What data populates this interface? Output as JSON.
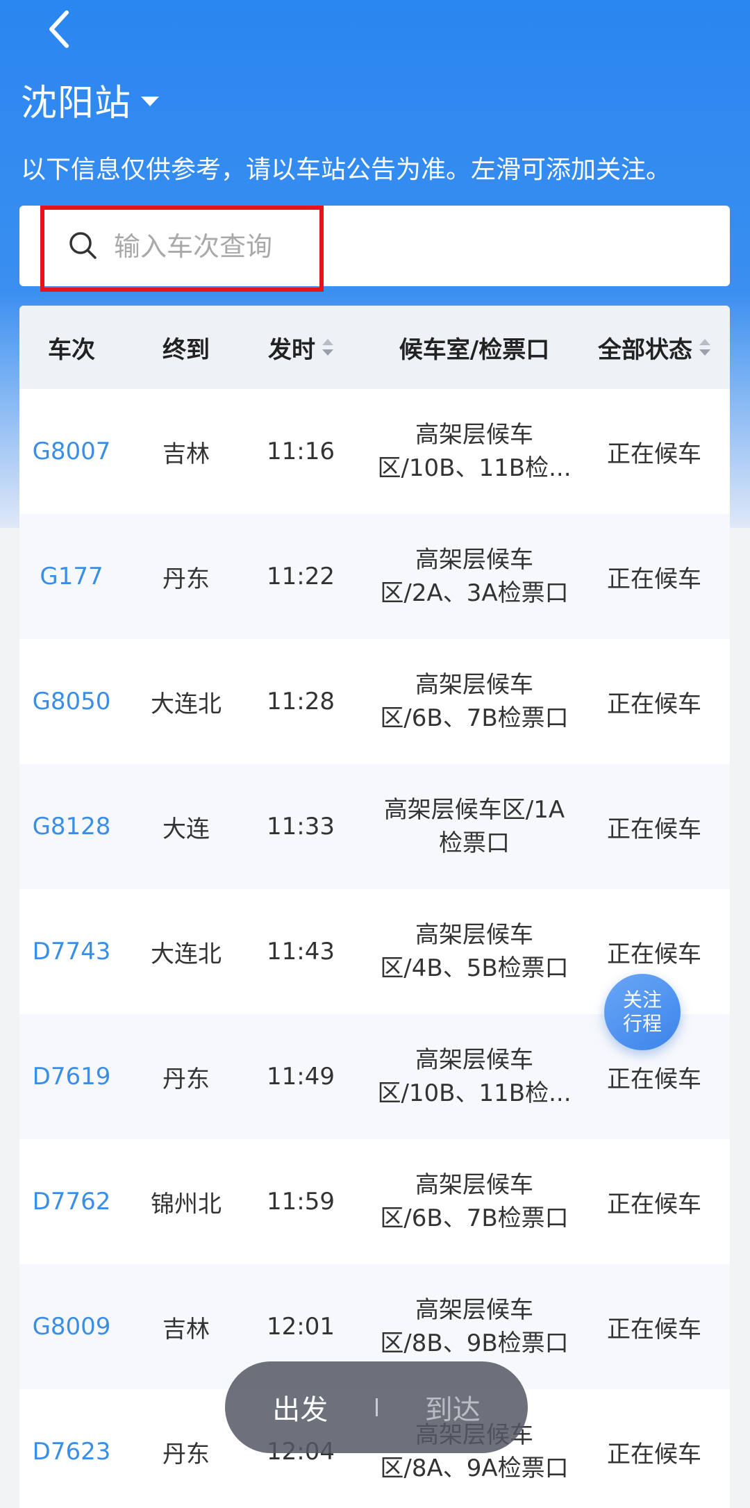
{
  "header": {
    "station": "沈阳站",
    "notice": "以下信息仅供参考，请以车站公告为准。左滑可添加关注。"
  },
  "search": {
    "placeholder": "输入车次查询"
  },
  "table": {
    "columns": [
      "车次",
      "终到",
      "发时",
      "候车室/检票口",
      "全部状态"
    ],
    "rows": [
      {
        "train": "G8007",
        "dest": "吉林",
        "time": "11:16",
        "room_line1": "高架层候车",
        "room_line2": "区/10B、11B检...",
        "status": "正在候车"
      },
      {
        "train": "G177",
        "dest": "丹东",
        "time": "11:22",
        "room_line1": "高架层候车",
        "room_line2": "区/2A、3A检票口",
        "status": "正在候车"
      },
      {
        "train": "G8050",
        "dest": "大连北",
        "time": "11:28",
        "room_line1": "高架层候车",
        "room_line2": "区/6B、7B检票口",
        "status": "正在候车"
      },
      {
        "train": "G8128",
        "dest": "大连",
        "time": "11:33",
        "room_line1": "高架层候车区/1A",
        "room_line2": "检票口",
        "status": "正在候车"
      },
      {
        "train": "D7743",
        "dest": "大连北",
        "time": "11:43",
        "room_line1": "高架层候车",
        "room_line2": "区/4B、5B检票口",
        "status": "正在候车"
      },
      {
        "train": "D7619",
        "dest": "丹东",
        "time": "11:49",
        "room_line1": "高架层候车",
        "room_line2": "区/10B、11B检...",
        "status": "正在候车"
      },
      {
        "train": "D7762",
        "dest": "锦州北",
        "time": "11:59",
        "room_line1": "高架层候车",
        "room_line2": "区/6B、7B检票口",
        "status": "正在候车"
      },
      {
        "train": "G8009",
        "dest": "吉林",
        "time": "12:01",
        "room_line1": "高架层候车",
        "room_line2": "区/8B、9B检票口",
        "status": "正在候车"
      },
      {
        "train": "D7623",
        "dest": "丹东",
        "time": "12:04",
        "room_line1": "高架层候车",
        "room_line2": "区/8A、9A检票口",
        "status": "正在候车"
      }
    ]
  },
  "follow_button": {
    "line1": "关注",
    "line2": "行程"
  },
  "bottom_switch": {
    "departure": "出发",
    "arrival": "到达"
  },
  "colors": {
    "accent": "#2a86f0",
    "train_link": "#3a8ee6",
    "highlight": "#e8121b"
  }
}
